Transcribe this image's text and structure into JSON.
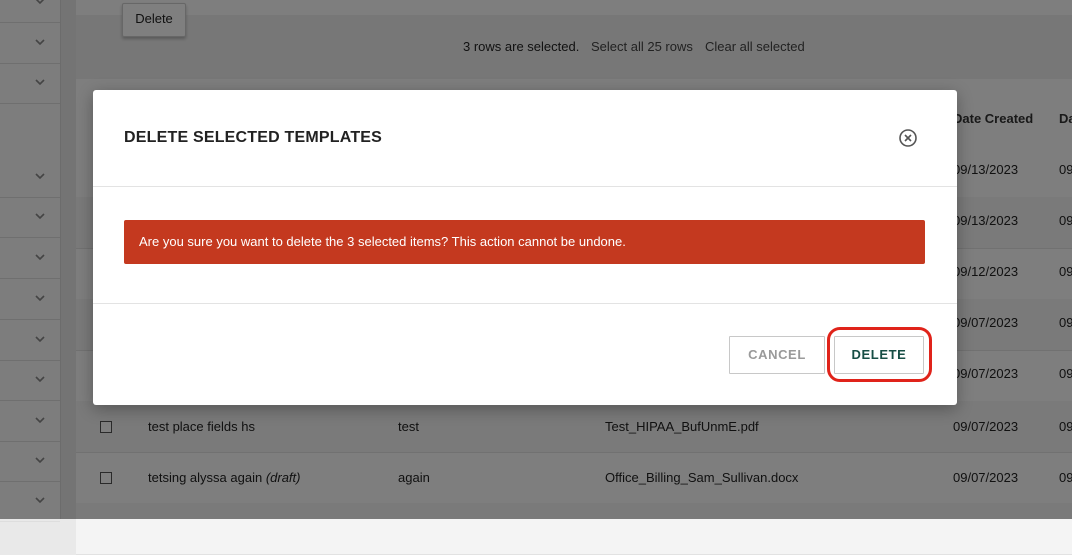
{
  "toolbar": {
    "delete_label": "Delete"
  },
  "selection": {
    "message": "3 rows are selected.",
    "select_all": "Select all 25 rows",
    "clear_all": "Clear all selected"
  },
  "table": {
    "headers": {
      "date_created": "Date Created",
      "date_modified": "Da"
    },
    "rows": [
      {
        "date": "09/13/2023",
        "date2": "09"
      },
      {
        "date": "09/13/2023",
        "date2": "09"
      },
      {
        "date": "09/12/2023",
        "date2": "09"
      },
      {
        "date": "09/07/2023",
        "date2": "09"
      },
      {
        "date": "09/07/2023",
        "date2": "09"
      },
      {
        "name": "test place fields hs",
        "draft": "",
        "description": "test",
        "file": "Test_HIPAA_BufUnmE.pdf",
        "date": "09/07/2023",
        "date2": "09"
      },
      {
        "name": "tetsing alyssa again",
        "draft": "(draft)",
        "description": "again",
        "file": "Office_Billing_Sam_Sullivan.docx",
        "date": "09/07/2023",
        "date2": "09"
      }
    ]
  },
  "modal": {
    "title": "DELETE SELECTED TEMPLATES",
    "message": "Are you sure you want to delete the 3 selected items? This action cannot be undone.",
    "cancel_label": "CANCEL",
    "delete_label": "DELETE"
  },
  "colors": {
    "alert": "#c4391f",
    "delete_text": "#174e45",
    "highlight": "#e0231a"
  }
}
